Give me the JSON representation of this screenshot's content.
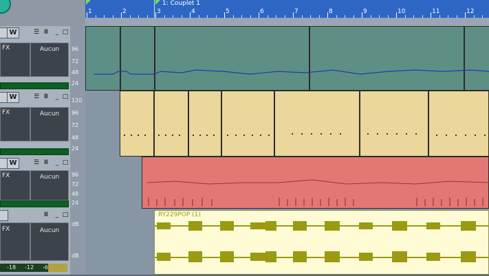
{
  "timeline": {
    "marker_label": "1: Couplet 1",
    "bars": [
      "1",
      "2",
      "3",
      "4",
      "5",
      "6",
      "7",
      "8",
      "9",
      "10",
      "11",
      "12"
    ]
  },
  "tracks": [
    {
      "id": "t1",
      "fx": "FX",
      "insert": "Aucun",
      "w_label": "W",
      "scale": [
        "96",
        "72",
        "48",
        "24"
      ]
    },
    {
      "id": "t2",
      "fx": "FX",
      "insert": "Aucun",
      "w_label": "W",
      "scale": [
        "120",
        "96",
        "72",
        "48",
        "24"
      ]
    },
    {
      "id": "t3",
      "fx": "FX",
      "insert": "Aucun",
      "w_label": "W",
      "scale": [
        "96",
        "72",
        "48",
        "24"
      ]
    },
    {
      "id": "t4",
      "fx": "FX",
      "insert": "Aucun",
      "scale": [
        "dB",
        "dB"
      ]
    }
  ],
  "audio_clip": {
    "name": "RY229POP (1)"
  },
  "bottom_meter": [
    "-18",
    "-12",
    "-6"
  ],
  "colors": {
    "ruler": "#2e66c6",
    "midi_green": "#5e8f84",
    "midi_yellow": "#ebd79c",
    "midi_red": "#e37774",
    "audio": "#fffbd5",
    "waveform": "#9b9a12"
  }
}
